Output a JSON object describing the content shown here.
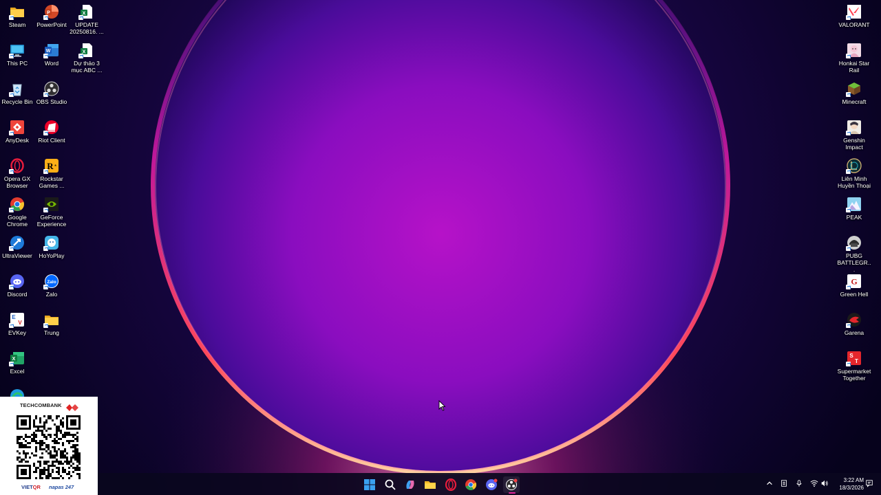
{
  "desktop": {
    "left_icons": [
      {
        "label": "Steam",
        "icon": "folder-icon"
      },
      {
        "label": "PowerPoint",
        "icon": "powerpoint-icon"
      },
      {
        "label": "UPDATE 20250816. ...",
        "icon": "excel-file-icon"
      },
      {
        "label": "This PC",
        "icon": "computer-icon"
      },
      {
        "label": "Word",
        "icon": "word-icon"
      },
      {
        "label": "Dự thảo 3 mục ABC ...",
        "icon": "excel-file-icon"
      },
      {
        "label": "Recycle Bin",
        "icon": "recycle-bin-icon"
      },
      {
        "label": "OBS Studio",
        "icon": "obs-icon"
      },
      {
        "label": "AnyDesk",
        "icon": "anydesk-icon"
      },
      {
        "label": "Riot Client",
        "icon": "riot-client-icon"
      },
      {
        "label": "Opera GX Browser",
        "icon": "opera-gx-icon"
      },
      {
        "label": "Rockstar Games ...",
        "icon": "rockstar-icon"
      },
      {
        "label": "Google Chrome",
        "icon": "chrome-icon"
      },
      {
        "label": "GeForce Experience",
        "icon": "geforce-icon"
      },
      {
        "label": "UltraViewer",
        "icon": "ultraviewer-icon"
      },
      {
        "label": "HoYoPlay",
        "icon": "hoyoplay-icon"
      },
      {
        "label": "Discord",
        "icon": "discord-icon"
      },
      {
        "label": "Zalo",
        "icon": "zalo-icon"
      },
      {
        "label": "EVKey",
        "icon": "evkey-icon"
      },
      {
        "label": "Trung",
        "icon": "folder-icon"
      },
      {
        "label": "Excel",
        "icon": "excel-icon"
      }
    ],
    "right_icons": [
      {
        "label": "VALORANT",
        "icon": "valorant-icon"
      },
      {
        "label": "Honkai Star Rail",
        "icon": "honkai-star-rail-icon"
      },
      {
        "label": "Minecraft",
        "icon": "minecraft-icon"
      },
      {
        "label": "Genshin Impact",
        "icon": "genshin-impact-icon"
      },
      {
        "label": "Liên Minh Huyền Thoại",
        "icon": "league-of-legends-icon"
      },
      {
        "label": "PEAK",
        "icon": "peak-icon"
      },
      {
        "label": "PUBG BATTLEGR...",
        "icon": "pubg-icon"
      },
      {
        "label": "Green Hell",
        "icon": "green-hell-icon"
      },
      {
        "label": "Garena",
        "icon": "garena-icon"
      },
      {
        "label": "Supermarket Together",
        "icon": "supermarket-together-icon"
      }
    ]
  },
  "qr_overlay": {
    "bank_name": "TECHCOMBANK",
    "vietqr_prefix": "VIET",
    "vietqr_suffix": "QR",
    "napas": "napas 247"
  },
  "taskbar": {
    "pinned": [
      "windows-start-icon",
      "search-icon",
      "copilot-icon",
      "file-explorer-icon",
      "opera-gx-icon",
      "chrome-icon",
      "discord-icon",
      "obs-icon"
    ],
    "tray": [
      "chevron-up-icon",
      "keyboard-layout-icon",
      "microphone-icon",
      "wifi-icon",
      "volume-icon"
    ],
    "time": "3:22 AM",
    "date": "18/3/2026"
  },
  "colors": {
    "accent": "#e4259a",
    "ring": "#ff4a6a",
    "background": "#080226"
  }
}
